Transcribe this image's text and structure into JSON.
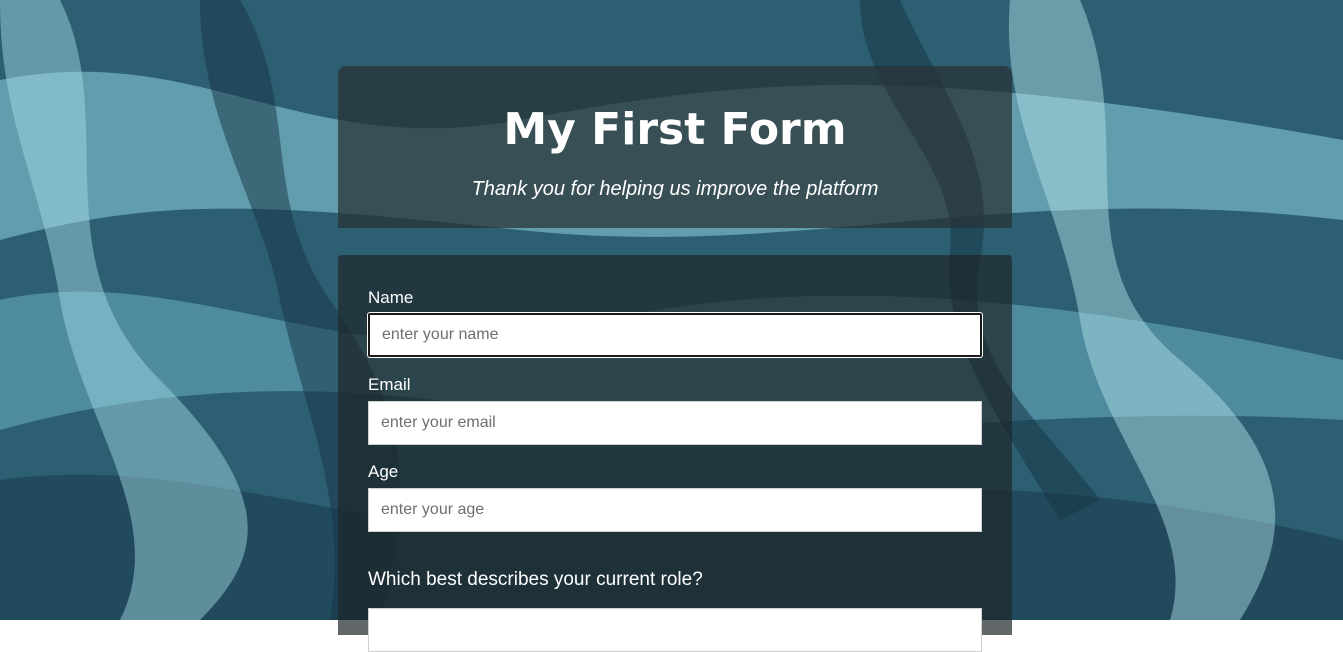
{
  "header": {
    "title": "My First Form",
    "subtitle": "Thank you for helping us improve the platform"
  },
  "form": {
    "name": {
      "label": "Name",
      "placeholder": "enter your name",
      "value": ""
    },
    "email": {
      "label": "Email",
      "placeholder": "enter your email",
      "value": ""
    },
    "age": {
      "label": "Age",
      "placeholder": "enter your age",
      "value": ""
    },
    "role": {
      "question": "Which best describes your current role?"
    }
  },
  "colors": {
    "card_background": "#283034",
    "text": "#ffffff",
    "input_background": "#ffffff"
  }
}
